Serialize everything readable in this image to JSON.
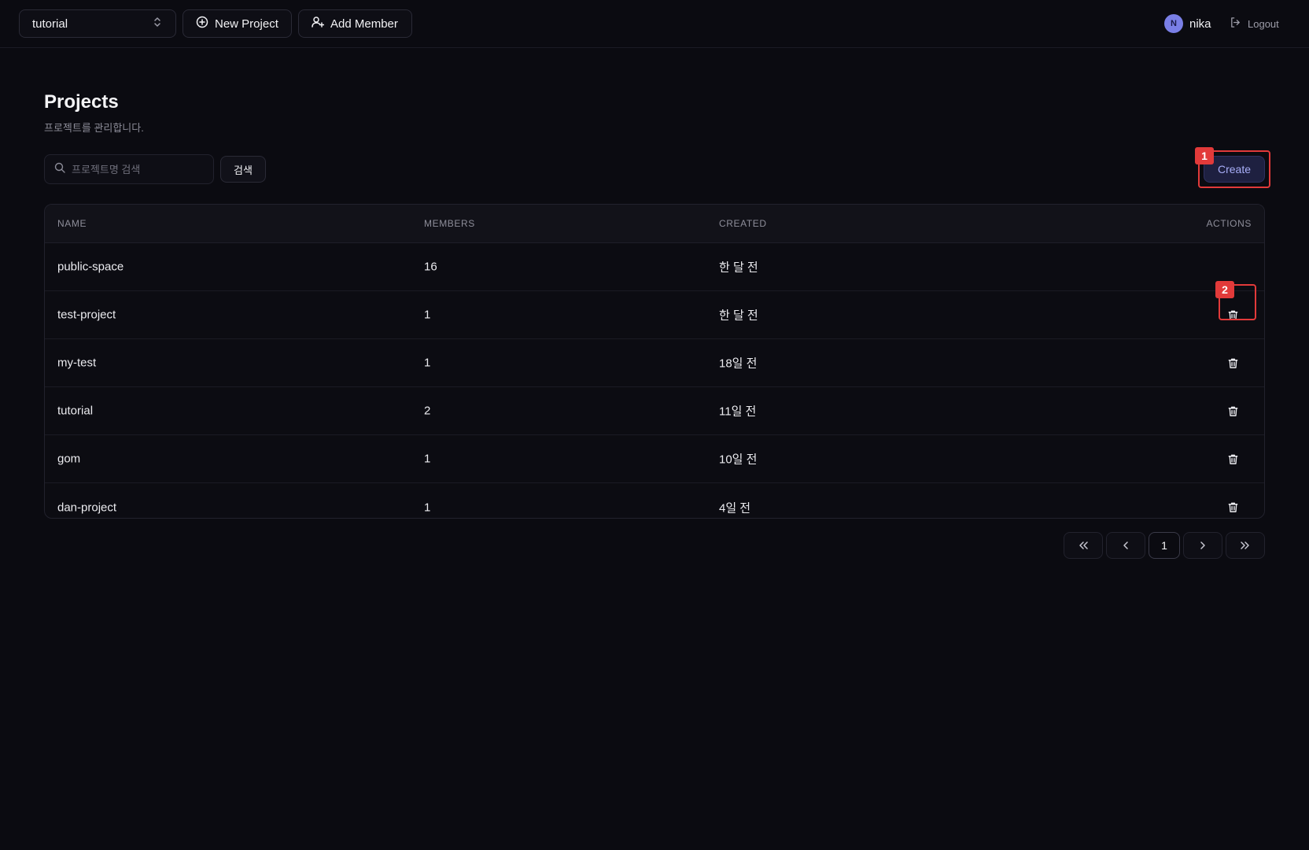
{
  "topbar": {
    "project_select_value": "tutorial",
    "new_project_label": "New Project",
    "add_member_label": "Add Member",
    "user_initial": "N",
    "user_name": "nika",
    "logout_label": "Logout"
  },
  "page": {
    "title": "Projects",
    "subtitle": "프로젝트를 관리합니다."
  },
  "toolbar": {
    "search_placeholder": "프로젝트명 검색",
    "search_button": "검색",
    "create_button": "Create"
  },
  "annotations": {
    "badge_1": "1",
    "badge_2": "2"
  },
  "table": {
    "headers": {
      "name": "NAME",
      "members": "MEMBERS",
      "created": "CREATED",
      "actions": "ACTIONS"
    },
    "rows": [
      {
        "name": "public-space",
        "members": "16",
        "created": "한 달 전",
        "deletable": false
      },
      {
        "name": "test-project",
        "members": "1",
        "created": "한 달 전",
        "deletable": true
      },
      {
        "name": "my-test",
        "members": "1",
        "created": "18일 전",
        "deletable": true
      },
      {
        "name": "tutorial",
        "members": "2",
        "created": "11일 전",
        "deletable": true
      },
      {
        "name": "gom",
        "members": "1",
        "created": "10일 전",
        "deletable": true
      },
      {
        "name": "dan-project",
        "members": "1",
        "created": "4일 전",
        "deletable": true
      }
    ]
  },
  "pagination": {
    "current_page": "1"
  },
  "colors": {
    "background": "#0b0b11",
    "accent": "#a8aef8",
    "highlight": "#e23a3a",
    "avatar": "#7a7fe6"
  },
  "icons": [
    "chevron-up-down-icon",
    "plus-circle-icon",
    "user-plus-icon",
    "logout-icon",
    "search-icon",
    "trash-icon",
    "double-chevron-left-icon",
    "chevron-left-icon",
    "chevron-right-icon",
    "double-chevron-right-icon"
  ]
}
